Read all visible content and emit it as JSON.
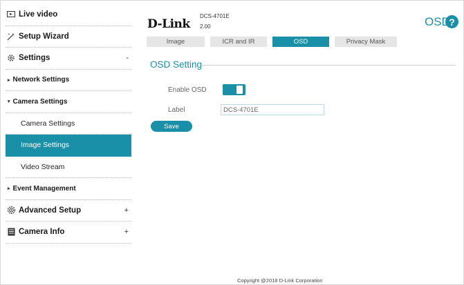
{
  "sidebar": {
    "items": [
      {
        "label": "Live video",
        "icon": "video-icon"
      },
      {
        "label": "Setup Wizard",
        "icon": "wand-icon"
      },
      {
        "label": "Settings",
        "icon": "gear-icon",
        "sign": "-"
      },
      {
        "label": "Network Settings",
        "bullet": "▸"
      },
      {
        "label": "Camera Settings",
        "bullet": "▾"
      },
      {
        "label": "Camera Settings"
      },
      {
        "label": "Image Settings"
      },
      {
        "label": "Video Stream"
      },
      {
        "label": "Event Management",
        "bullet": "▸"
      },
      {
        "label": "Advanced Setup",
        "icon": "advanced-gear-icon",
        "sign": "+"
      },
      {
        "label": "Camera Info",
        "icon": "document-icon",
        "sign": "+"
      }
    ]
  },
  "header": {
    "logo": "D-Link",
    "model": "DCS-4701E",
    "version": "2.00",
    "page_title": "OSD",
    "help_symbol": "?"
  },
  "tabs": [
    "Image",
    "ICR and IR",
    "OSD",
    "Privacy Mask"
  ],
  "active_tab": "OSD",
  "section": {
    "title": "OSD Setting",
    "enable_label": "Enable OSD",
    "enable_value": true,
    "label_label": "Label",
    "label_value": "DCS-4701E",
    "save_label": "Save"
  },
  "footer": "Copyright @2018 D-Link Corporation",
  "colors": {
    "accent": "#1a8fa8",
    "tab_inactive": "#e6e6e6"
  }
}
